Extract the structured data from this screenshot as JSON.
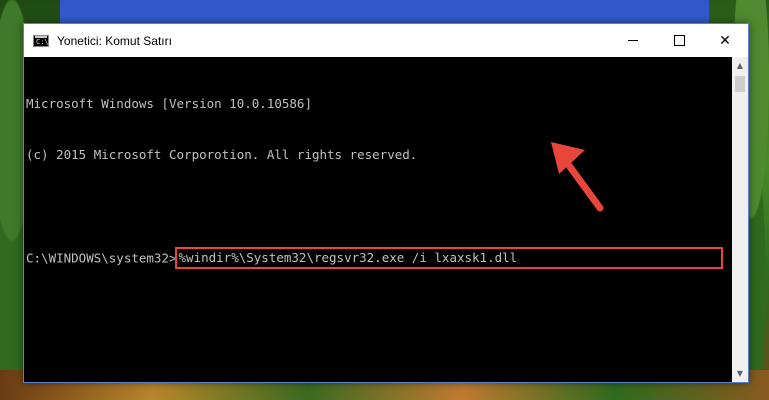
{
  "window": {
    "title": "Yonetici: Komut Satırı",
    "icon_label": "C:\\"
  },
  "controls": {
    "minimize": "minimize-icon",
    "maximize": "maximize-icon",
    "close": "✕"
  },
  "console": {
    "line1": "Microsoft Windows [Version 10.0.10586]",
    "line2": "(c) 2015 Microsoft Corporotion. All rights reserved.",
    "prompt": "C:\\WINDOWS\\system32>",
    "command": "%windir%\\System32\\regsvr32.exe /i lxaxsk1.dll"
  },
  "colors": {
    "highlight": "#e8463a",
    "console_bg": "#000000",
    "console_text": "#c0c0c0"
  },
  "scrollbar": {
    "up": "▲",
    "down": "▼"
  }
}
